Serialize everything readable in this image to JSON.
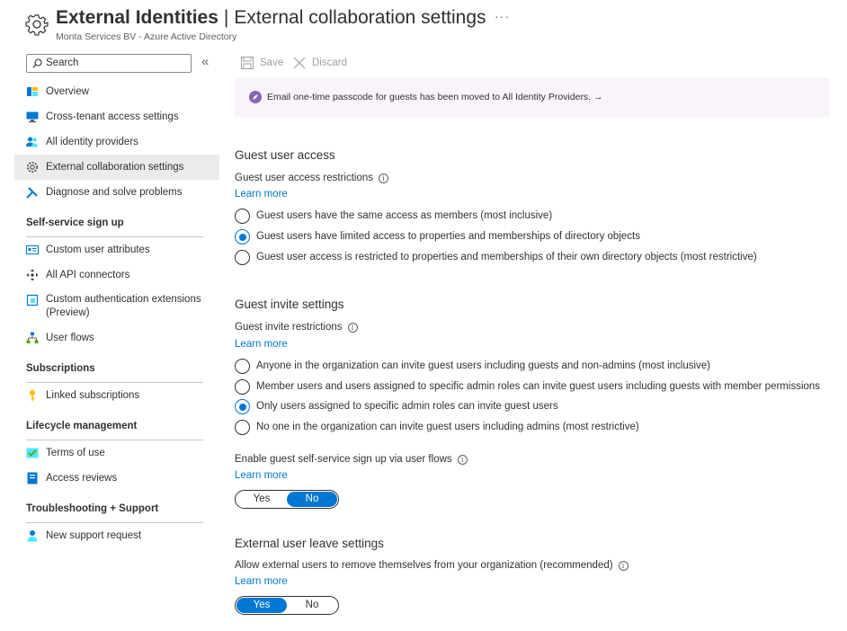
{
  "header": {
    "title_bold": "External Identities",
    "title_sep": "|",
    "title_rest": "External collaboration settings",
    "more": "···",
    "subtitle": "Monta Services BV - Azure Active Directory"
  },
  "sidebar": {
    "search_placeholder": "Search",
    "collapse": "«",
    "items": [
      {
        "label": "Overview",
        "icon": "overview-icon"
      },
      {
        "label": "Cross-tenant access settings",
        "icon": "monitor-icon"
      },
      {
        "label": "All identity providers",
        "icon": "users-icon"
      },
      {
        "label": "External collaboration settings",
        "icon": "gear-icon",
        "active": true
      },
      {
        "label": "Diagnose and solve problems",
        "icon": "wrench-icon"
      }
    ],
    "sections": [
      {
        "title": "Self-service sign up",
        "items": [
          {
            "label": "Custom user attributes",
            "icon": "card-icon"
          },
          {
            "label": "All API connectors",
            "icon": "connector-icon"
          },
          {
            "label": "Custom authentication extensions (Preview)",
            "icon": "extension-icon"
          },
          {
            "label": "User flows",
            "icon": "flow-icon"
          }
        ]
      },
      {
        "title": "Subscriptions",
        "items": [
          {
            "label": "Linked subscriptions",
            "icon": "key-icon"
          }
        ]
      },
      {
        "title": "Lifecycle management",
        "items": [
          {
            "label": "Terms of use",
            "icon": "checklist-icon"
          },
          {
            "label": "Access reviews",
            "icon": "review-icon"
          }
        ]
      },
      {
        "title": "Troubleshooting + Support",
        "items": [
          {
            "label": "New support request",
            "icon": "support-person-icon"
          }
        ]
      }
    ]
  },
  "toolbar": {
    "save": "Save",
    "discard": "Discard"
  },
  "banner": {
    "text": "Email one-time passcode for guests has been moved to All Identity Providers.",
    "arrow": "→"
  },
  "guest_access": {
    "heading": "Guest user access",
    "label": "Guest user access restrictions",
    "learn_more": "Learn more",
    "options": [
      "Guest users have the same access as members (most inclusive)",
      "Guest users have limited access to properties and memberships of directory objects",
      "Guest user access is restricted to properties and memberships of their own directory objects (most restrictive)"
    ],
    "selected_index": 1
  },
  "guest_invite": {
    "heading": "Guest invite settings",
    "label": "Guest invite restrictions",
    "learn_more": "Learn more",
    "options": [
      "Anyone in the organization can invite guest users including guests and non-admins (most inclusive)",
      "Member users and users assigned to specific admin roles can invite guest users including guests with member permissions",
      "Only users assigned to specific admin roles can invite guest users",
      "No one in the organization can invite guest users including admins (most restrictive)"
    ],
    "selected_index": 2,
    "self_service": {
      "label": "Enable guest self-service sign up via user flows",
      "learn_more": "Learn more",
      "yes": "Yes",
      "no": "No",
      "value": "No"
    }
  },
  "leave": {
    "heading": "External user leave settings",
    "label": "Allow external users to remove themselves from your organization (recommended)",
    "learn_more": "Learn more",
    "yes": "Yes",
    "no": "No",
    "value": "Yes"
  },
  "info_glyph": "i",
  "colors": {
    "accent": "#0078d4",
    "banner_bg": "#f9f4fa",
    "active_nav": "#edebe9"
  }
}
